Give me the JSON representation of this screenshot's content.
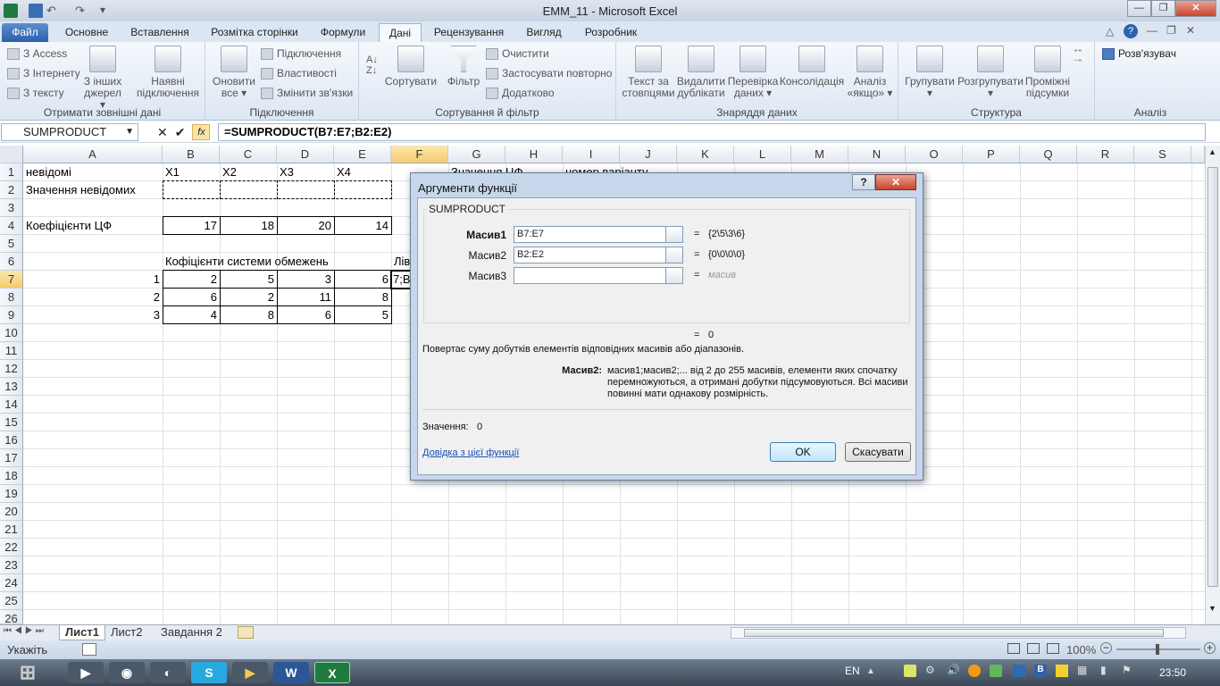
{
  "window": {
    "title": "EMM_11  -  Microsoft Excel",
    "min": "—",
    "max": "❐",
    "close": "✕"
  },
  "tabs": [
    {
      "label": "Файл"
    },
    {
      "label": "Основне"
    },
    {
      "label": "Вставлення"
    },
    {
      "label": "Розмітка сторінки"
    },
    {
      "label": "Формули"
    },
    {
      "label": "Дані"
    },
    {
      "label": "Рецензування"
    },
    {
      "label": "Вигляд"
    },
    {
      "label": "Розробник"
    }
  ],
  "ribbon": {
    "get_data": {
      "access": "З Access",
      "internet": "З Інтернету",
      "text": "З тексту",
      "other": "З інших джерел ▾",
      "existing": "Наявні підключення",
      "label": "Отримати зовнішні дані"
    },
    "connections": {
      "refresh": "Оновити все ▾",
      "connections": "Підключення",
      "properties": "Властивості",
      "edit_links": "Змінити зв'язки",
      "label": "Підключення"
    },
    "sort": {
      "sort": "Сортувати",
      "filter": "Фільтр",
      "clear": "Очистити",
      "reapply": "Застосувати повторно",
      "advanced": "Додатково",
      "label": "Сортування й фільтр"
    },
    "tools": {
      "text_cols": "Текст за стовпцями",
      "remove_dup": "Видалити дублікати",
      "validation": "Перевірка даних ▾",
      "consolidate": "Консолідація",
      "whatif": "Аналіз «якщо» ▾",
      "label": "Знаряддя даних"
    },
    "outline": {
      "group": "Групувати ▾",
      "ungroup": "Розгрупувати ▾",
      "subtotal": "Проміжні підсумки",
      "label": "Структура"
    },
    "analysis": {
      "solver": "Розв'язувач",
      "label": "Аналіз"
    }
  },
  "formula_bar": {
    "name_box": "SUMPRODUCT",
    "cancel": "✕",
    "enter": "✔",
    "fx": "fx",
    "formula": "=SUMPRODUCT(B7:E7;B2:E2)"
  },
  "columns": [
    "A",
    "B",
    "C",
    "D",
    "E",
    "F",
    "G",
    "H",
    "I",
    "J",
    "K",
    "L",
    "M",
    "N",
    "O",
    "P",
    "Q",
    "R",
    "S"
  ],
  "rows": [
    "1",
    "2",
    "3",
    "4",
    "5",
    "6",
    "7",
    "8",
    "9",
    "10",
    "11",
    "12",
    "13",
    "14",
    "15",
    "16",
    "17",
    "18",
    "19",
    "20",
    "21",
    "22",
    "23",
    "24",
    "25",
    "26"
  ],
  "cells": {
    "a1": "невідомі",
    "b1": "X1",
    "c1": "X2",
    "d1": "X3",
    "e1": "X4",
    "g1": "Значення ЦФ",
    "i1": "номер варіанту",
    "a2": "Значення невідомих",
    "a4": "Коефіцієнти ЦФ",
    "b4": "17",
    "c4": "18",
    "d4": "20",
    "e4": "14",
    "b6": "Кофіцієнти системи обмежень",
    "f6": "Лів",
    "a7": "1",
    "b7": "2",
    "c7": "5",
    "d7": "3",
    "e7": "6",
    "f7": "7;B2",
    "a8": "2",
    "b8": "6",
    "c8": "2",
    "d8": "11",
    "e8": "8",
    "a9": "3",
    "b9": "4",
    "c9": "8",
    "d9": "6",
    "e9": "5"
  },
  "sheets": {
    "s1": "Лист1",
    "s2": "Лист2",
    "s3": "Завдання 2"
  },
  "status": {
    "mode": "Укажіть",
    "zoom": "100%"
  },
  "taskbar": {
    "lang": "EN",
    "time": "23:50"
  },
  "dialog": {
    "title": "Аргументи функції",
    "help_btn": "?",
    "func": "SUMPRODUCT",
    "arg1": {
      "label": "Масив1",
      "value": "B7:E7",
      "result": "{2\\5\\3\\6}"
    },
    "arg2": {
      "label": "Масив2",
      "value": "B2:E2",
      "result": "{0\\0\\0\\0}"
    },
    "arg3": {
      "label": "Масив3",
      "value": "",
      "result": "масив"
    },
    "eq": "=",
    "total": "0",
    "description": "Повертає суму добутків елементів відповідних масивів або діапазонів.",
    "arg_name": "Масив2:",
    "arg_desc": "масив1;масив2;... від 2 до 255 масивів, елементи яких спочатку перемножуються, а отримані добутки підсумовуються. Всі масиви повинні мати однакову розмірність.",
    "value_label": "Значення:",
    "value": "0",
    "help_link": "Довідка з цієї функції",
    "ok": "OK",
    "cancel": "Скасувати"
  }
}
